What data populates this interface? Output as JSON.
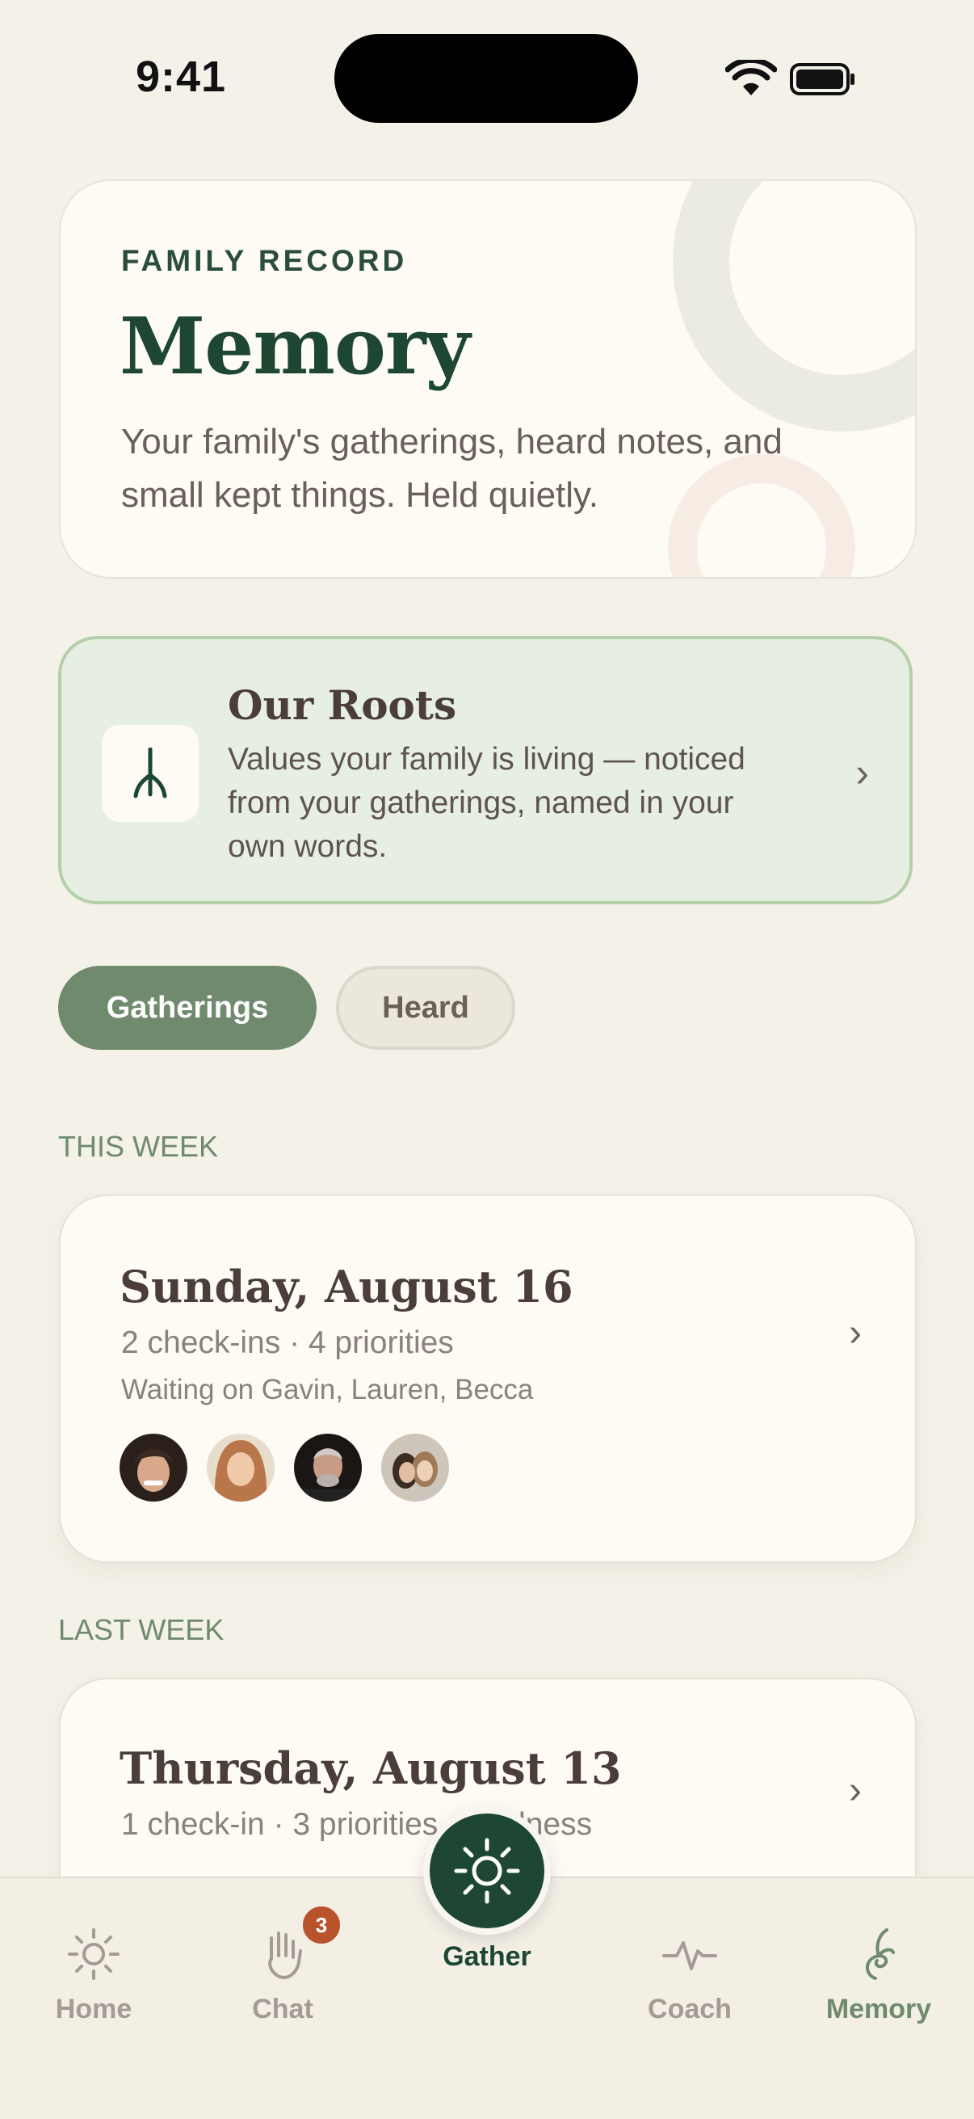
{
  "status_bar": {
    "time": "9:41"
  },
  "hero": {
    "eyebrow": "FAMILY RECORD",
    "title": "Memory",
    "description": "Your family's gatherings, heard notes, and small kept things. Held quietly."
  },
  "roots": {
    "title": "Our Roots",
    "description": "Values your family is living — noticed from your gatherings, named in your own words.",
    "chevron": "›"
  },
  "tabs": {
    "gatherings": "Gatherings",
    "heard": "Heard",
    "selected": "Gatherings"
  },
  "sections": [
    {
      "label": "THIS WEEK",
      "card": {
        "date": "Sunday, August 16",
        "meta": "2 check-ins · 4 priorities",
        "sub": "Waiting on Gavin, Lauren, Becca",
        "chevron": "›"
      }
    },
    {
      "label": "LAST WEEK",
      "card": {
        "date": "Thursday, August 13",
        "meta": "1 check-in · 3 priorities · gladness",
        "chevron": "›"
      }
    }
  ],
  "tab_bar": {
    "home": "Home",
    "chat": "Chat",
    "chat_badge": "3",
    "gather": "Gather",
    "coach": "Coach",
    "memory": "Memory",
    "active": "Memory"
  },
  "colors": {
    "background": "#f4f1e8",
    "brand_green": "#1d4733",
    "sage": "#6f8a6d",
    "badge": "#b8532c",
    "roots_bg": "#e7efe2"
  }
}
